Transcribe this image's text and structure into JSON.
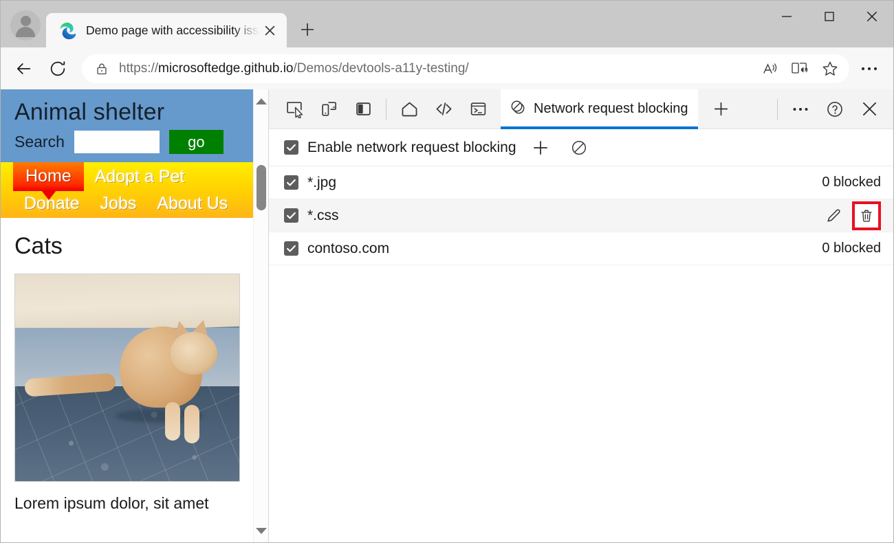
{
  "browser": {
    "profile_icon": "person-avatar-icon",
    "tab": {
      "favicon": "edge-logo-icon",
      "title": "Demo page with accessibility issu",
      "close_icon": "close-icon"
    },
    "new_tab_icon": "plus-icon",
    "window_controls": {
      "minimize": "minimize-icon",
      "maximize": "maximize-icon",
      "close": "close-icon"
    },
    "nav": {
      "back_icon": "back-arrow-icon",
      "refresh_icon": "refresh-icon"
    },
    "omnibox": {
      "lock_icon": "lock-icon",
      "url_scheme": "https://",
      "url_host": "microsoftedge.github.io",
      "url_path": "/Demos/devtools-a11y-testing/",
      "read_aloud_icon": "read-aloud-icon",
      "immersive_reader_icon": "immersive-reader-icon",
      "favorite_icon": "star-icon"
    },
    "more_icon": "ellipsis-icon"
  },
  "page": {
    "header": {
      "site_title": "Animal shelter",
      "search_label": "Search",
      "search_value": "",
      "search_placeholder": "",
      "go_button": "go"
    },
    "nav_items": [
      {
        "label": "Home",
        "active": true
      },
      {
        "label": "Adopt a Pet",
        "active": false
      },
      {
        "label": "Donate",
        "active": false
      },
      {
        "label": "Jobs",
        "active": false
      },
      {
        "label": "About Us",
        "active": false
      }
    ],
    "heading": "Cats",
    "photo_alt": "cat-photo",
    "caption": "Lorem ipsum dolor, sit amet",
    "scrollbar": {
      "up_icon": "scroll-up-arrow-icon",
      "down_icon": "scroll-down-arrow-icon"
    }
  },
  "devtools": {
    "toolbar_icons": [
      {
        "name": "inspect-element-icon"
      },
      {
        "name": "device-emulation-icon"
      },
      {
        "name": "dock-side-icon"
      },
      {
        "name": "home-icon"
      },
      {
        "name": "elements-icon"
      },
      {
        "name": "console-icon"
      }
    ],
    "active_tab": {
      "icon": "network-request-blocking-icon",
      "label": "Network request blocking"
    },
    "add_tab_icon": "plus-icon",
    "more_tools_icon": "ellipsis-icon",
    "help_icon": "help-icon",
    "close_icon": "close-icon",
    "blocking": {
      "enable_checkbox_checked": true,
      "enable_label": "Enable network request blocking",
      "add_pattern_icon": "plus-icon",
      "remove_all_icon": "block-circle-icon",
      "rows": [
        {
          "checked": true,
          "pattern": "*.jpg",
          "status": "0 blocked",
          "hovered": false
        },
        {
          "checked": true,
          "pattern": "*.css",
          "status": "",
          "hovered": true,
          "edit_icon": "pencil-icon",
          "delete_icon": "trash-icon"
        },
        {
          "checked": true,
          "pattern": "contoso.com",
          "status": "0 blocked",
          "hovered": false
        }
      ]
    }
  },
  "annotation": {
    "highlight_color": "#e81123",
    "target": "delete-pattern-button"
  }
}
